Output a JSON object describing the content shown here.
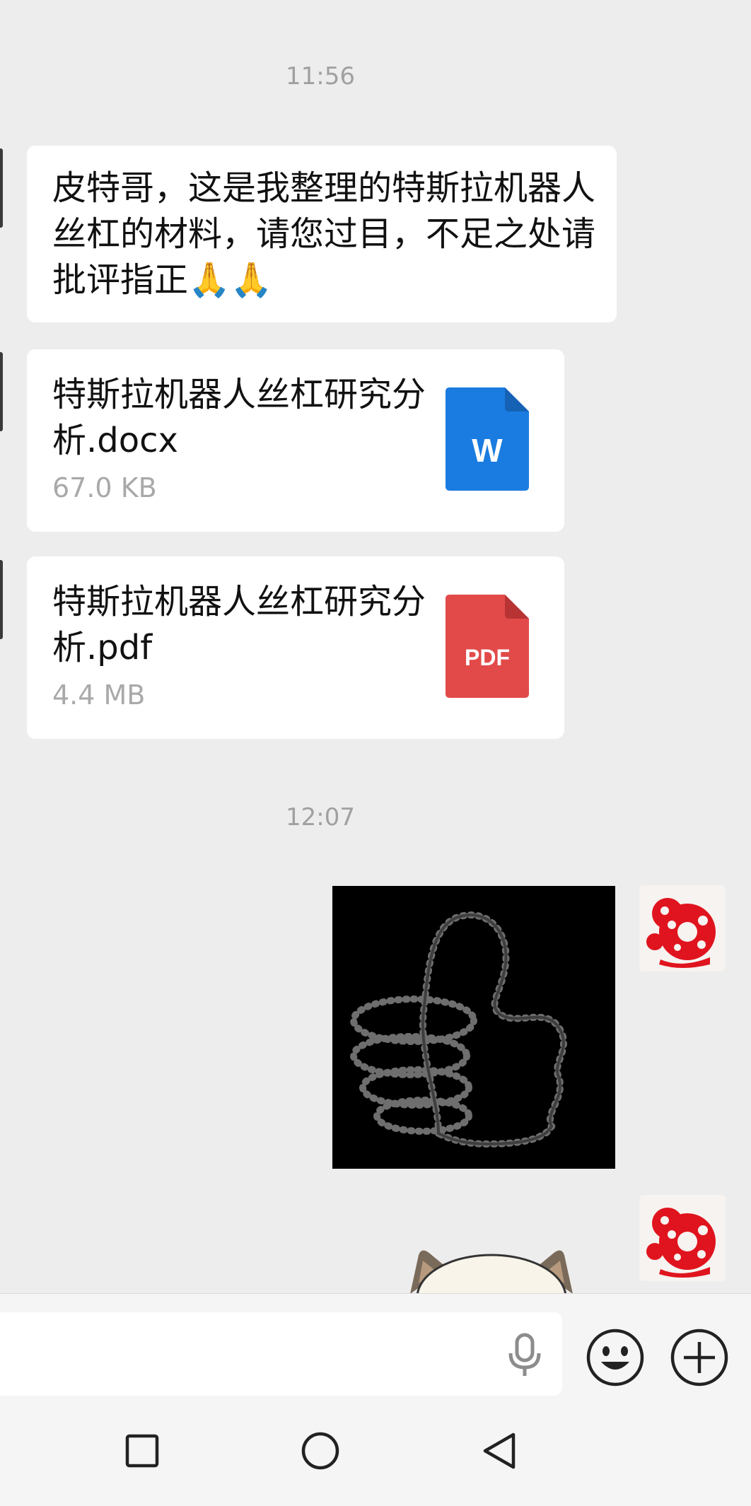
{
  "chat": {
    "timestamp_1": "11:56",
    "text_message": "皮特哥，这是我整理的特斯拉机器人丝杠的材料，请您过目，不足之处请批评指正🙏🙏",
    "files": [
      {
        "name": "特斯拉机器人丝杠研究分析.docx",
        "size": "67.0 KB",
        "icon_label": "W",
        "icon_color": "#1a7ce0",
        "icon": "word-file-icon"
      },
      {
        "name": "特斯拉机器人丝杠研究分析.pdf",
        "size": "4.4 MB",
        "icon_label": "PDF",
        "icon_color": "#e24a4a",
        "icon": "pdf-file-icon"
      }
    ],
    "timestamp_2": "12:07"
  },
  "input_bar": {
    "icons": [
      "microphone-icon",
      "emoji-icon",
      "plus-icon"
    ]
  },
  "nav_bar": {
    "icons": [
      "square-recents-icon",
      "circle-home-icon",
      "triangle-back-icon"
    ]
  },
  "colors": {
    "background": "#ededed",
    "bubble": "#ffffff",
    "timestamp": "#a0a0a0",
    "avatar_red": "#e0141e"
  }
}
